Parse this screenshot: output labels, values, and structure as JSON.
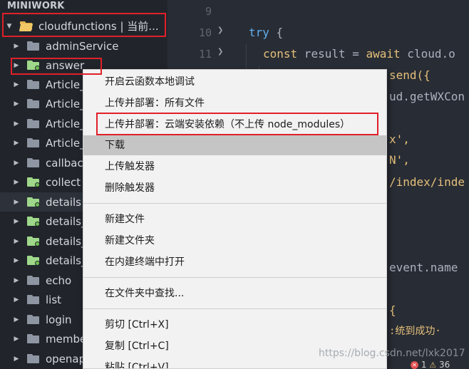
{
  "explorer": {
    "title": "MINIWORK",
    "root": {
      "label": "cloudfunctions | 当前..."
    },
    "items": [
      {
        "label": "adminService",
        "icon": "grey"
      },
      {
        "label": "answer",
        "icon": "cloud"
      },
      {
        "label": "Article_",
        "icon": "grey"
      },
      {
        "label": "Article_",
        "icon": "grey"
      },
      {
        "label": "Article_",
        "icon": "grey"
      },
      {
        "label": "Article_",
        "icon": "grey"
      },
      {
        "label": "callbac",
        "icon": "grey"
      },
      {
        "label": "collect",
        "icon": "cloud"
      },
      {
        "label": "details",
        "icon": "cloud"
      },
      {
        "label": "details_",
        "icon": "cloud"
      },
      {
        "label": "details_",
        "icon": "cloud"
      },
      {
        "label": "details_",
        "icon": "cloud"
      },
      {
        "label": "echo",
        "icon": "grey"
      },
      {
        "label": "list",
        "icon": "grey"
      },
      {
        "label": "login",
        "icon": "grey"
      },
      {
        "label": "membe",
        "icon": "grey"
      },
      {
        "label": "openap",
        "icon": "grey"
      }
    ]
  },
  "editor": {
    "line_numbers": [
      "9",
      "10",
      "11"
    ],
    "lines": {
      "try_kw": "try",
      "try_brace": " {",
      "const_kw": "const",
      "result_text": " result = ",
      "await_kw": "await",
      "cloud_text": " cloud.o",
      "send_text": "send({",
      "getwx_text": "ud.getWXCon",
      "x_text": "x',",
      "n_text": "N',",
      "index_text": "/index/inde",
      "event_text": "event.name",
      "brace_text": "{",
      "cut_text": ":统到成功·"
    }
  },
  "context_menu": {
    "items": [
      "开启云函数本地调试",
      "上传并部署：所有文件",
      "上传并部署：云端安装依赖（不上传 node_modules）",
      "下载",
      "上传触发器",
      "删除触发器",
      "新建文件",
      "新建文件夹",
      "在内建终端中打开",
      "在文件夹中查找...",
      "剪切  [Ctrl+X]",
      "复制  [Ctrl+C]",
      "粘贴  [Ctrl+V]"
    ],
    "active_index": 3
  },
  "watermark": "https://blog.csdn.net/lxk2017",
  "status": {
    "errors": "1",
    "warnings": "36"
  },
  "colors": {
    "annotation": "#e0202a",
    "cloud_folder": "#9fd88a",
    "menu_active": "#c5c5c5"
  }
}
